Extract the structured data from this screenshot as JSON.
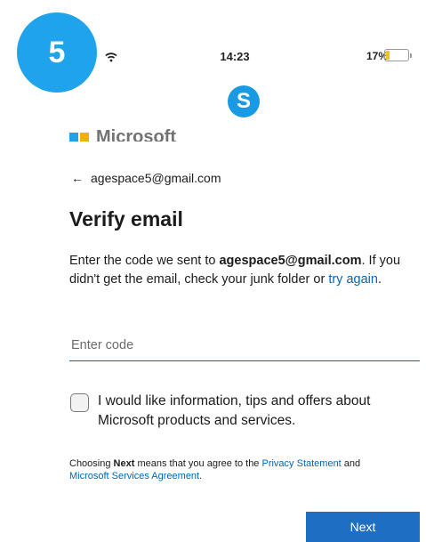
{
  "step_badge": "5",
  "status_bar": {
    "time": "14:23",
    "battery_percent": "17%",
    "battery_level": 0.17
  },
  "logo": {
    "skype_letter": "S",
    "microsoft_text": "Microsoft"
  },
  "account": {
    "back_arrow": "←",
    "email": "agespace5@gmail.com"
  },
  "title": "Verify email",
  "instructions": {
    "part1": "Enter the code we sent to ",
    "email": "agespace5@gmail.com",
    "part2": ". If you didn't get the email, check your junk folder or ",
    "link": "try again",
    "end": "."
  },
  "code_input": {
    "placeholder": "Enter code",
    "value": ""
  },
  "marketing_checkbox": {
    "checked": false,
    "label": "I would like information, tips and offers about Microsoft products and services."
  },
  "terms": {
    "part1": "Choosing ",
    "next_bold": "Next",
    "part2": " means that you agree to the ",
    "privacy_link": "Privacy Statement",
    "part3": " and ",
    "msa_link": "Microsoft Services Agreement",
    "end": "."
  },
  "next_button": "Next",
  "colors": {
    "badge": "#1fa3ea",
    "skype": "#1b9ae4",
    "link": "#0067b8",
    "button": "#1e6fc4",
    "battery": "#f3c21a"
  }
}
